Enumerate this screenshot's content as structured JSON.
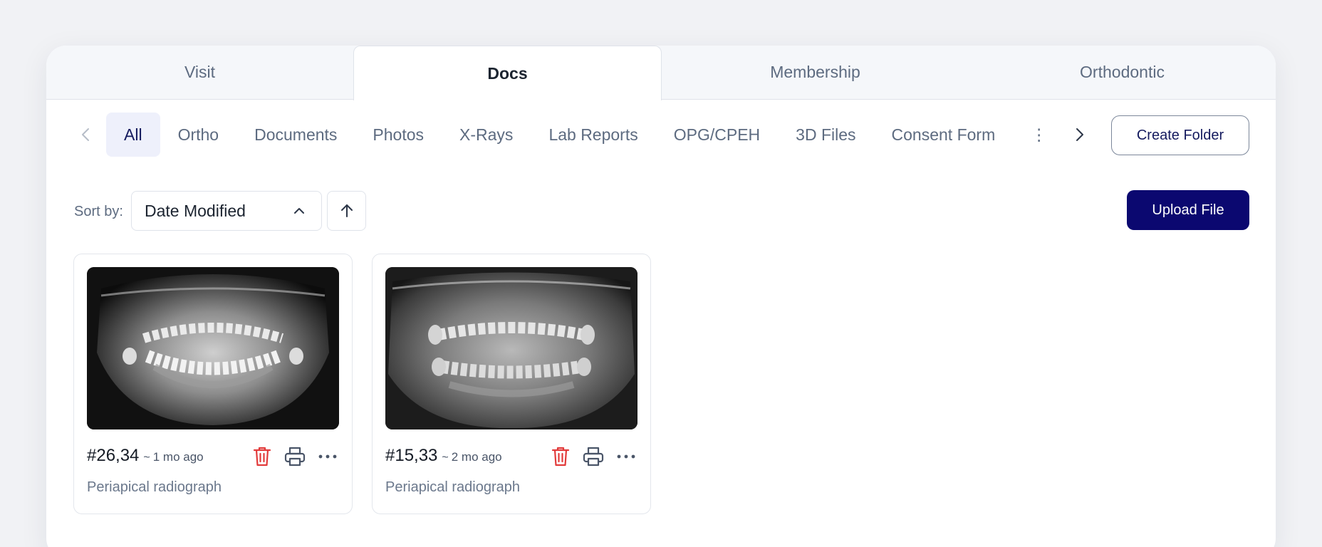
{
  "tabs": [
    {
      "label": "Visit",
      "active": false
    },
    {
      "label": "Docs",
      "active": true
    },
    {
      "label": "Membership",
      "active": false
    },
    {
      "label": "Orthodontic",
      "active": false
    }
  ],
  "folders": {
    "items": [
      "All",
      "Ortho",
      "Documents",
      "Photos",
      "X-Rays",
      "Lab Reports",
      "OPG/CPEH",
      "3D Files",
      "Consent Form",
      "⋮"
    ],
    "active": "All",
    "create_label": "Create Folder"
  },
  "sort": {
    "label": "Sort by:",
    "value": "Date Modified",
    "direction": "ascending"
  },
  "upload_label": "Upload File",
  "files": [
    {
      "id": "#26,34",
      "ago": "1 mo ago",
      "description": "Periapical radiograph"
    },
    {
      "id": "#15,33",
      "ago": "2 mo ago",
      "description": "Periapical radiograph"
    }
  ],
  "colors": {
    "primary": "#0b0870",
    "delete": "#e23b3b",
    "active_chip_bg": "#eef0fb"
  }
}
